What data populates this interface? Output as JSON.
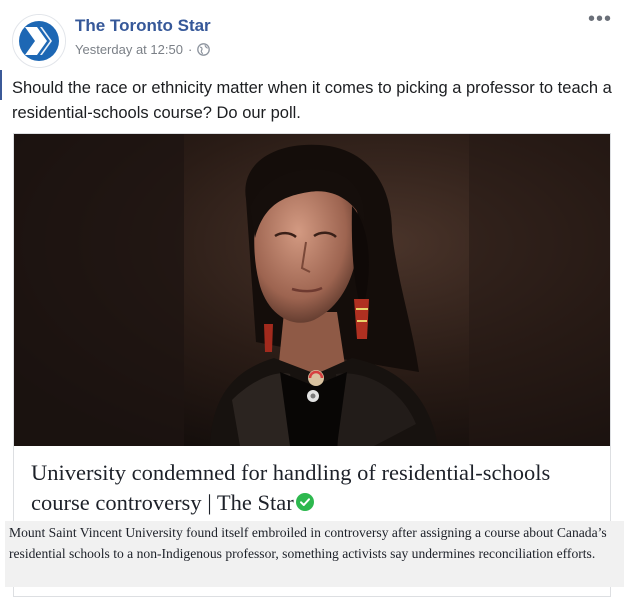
{
  "post": {
    "page_name": "The Toronto Star",
    "timestamp": "Yesterday at 12:50",
    "separator": "·",
    "privacy_icon": "globe-icon",
    "more_icon": "more-options-icon",
    "more_label": "•••",
    "text": "Should the race or ethnicity matter when it comes to picking a professor to teach a residential-schools course? Do our poll."
  },
  "link_card": {
    "title": "University condemned for handling of residential-schools course controversy | The Star",
    "verified_icon": "verified-check-icon",
    "description": "Mount Saint Vincent University found itself embroiled in controversy after assigning a course about Canada’s residential schools to a non-Indigenous professor, something activists say undermines reconciliation efforts."
  },
  "colors": {
    "brand_blue": "#1d67b4",
    "page_link": "#365899",
    "verified_green": "#2db84e"
  }
}
